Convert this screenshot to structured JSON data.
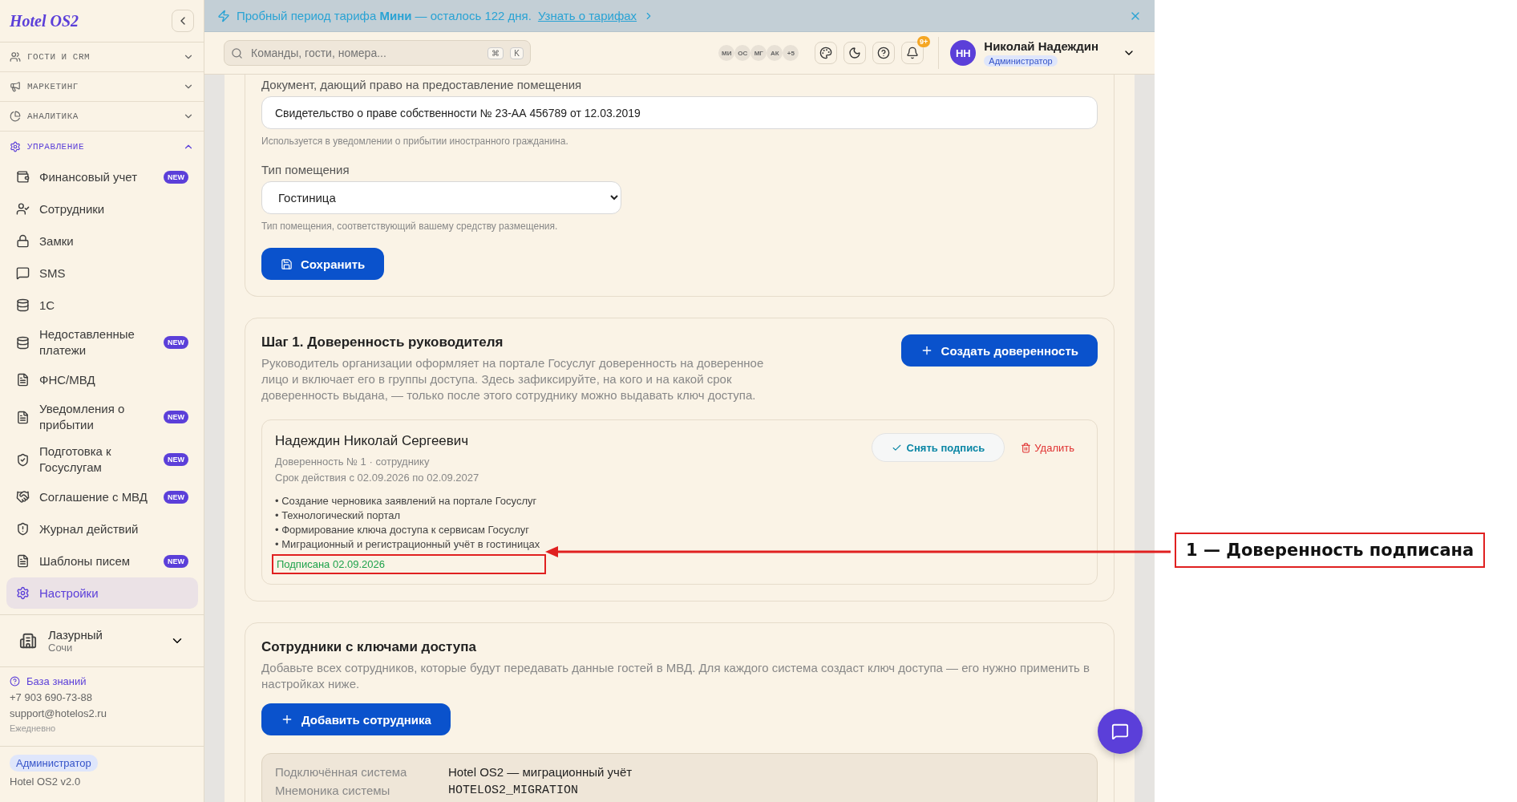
{
  "banner": {
    "text_before": "Пробный период тарифа",
    "tariff": "Мини",
    "text_after": "— осталось 122 дня.",
    "link": "Узнать о тарифах"
  },
  "search": {
    "placeholder": "Команды, гости, номера...",
    "keys": [
      "⌘",
      "K"
    ]
  },
  "avatars": [
    "МИ",
    "ОС",
    "МГ",
    "АК"
  ],
  "avatars_more": "+5",
  "notifications": "9+",
  "user": {
    "initials": "НН",
    "name": "Николай Надеждин",
    "role": "Администратор"
  },
  "sidebar": {
    "logo": "Hotel OS2",
    "sections": [
      {
        "label": "ГОСТИ И CRM",
        "expanded": false
      },
      {
        "label": "МАРКЕТИНГ",
        "expanded": false
      },
      {
        "label": "АНАЛИТИКА",
        "expanded": false
      },
      {
        "label": "УПРАВЛЕНИЕ",
        "expanded": true,
        "items": [
          {
            "label": "Финансовый учет",
            "badge": "NEW",
            "selected": false
          },
          {
            "label": "Сотрудники",
            "selected": false
          },
          {
            "label": "Замки",
            "selected": false
          },
          {
            "label": "SMS",
            "selected": false
          },
          {
            "label": "1С",
            "selected": false
          },
          {
            "label": "Недоставленные платежи",
            "badge": "NEW",
            "selected": false
          },
          {
            "label": "ФНС/МВД",
            "selected": false
          },
          {
            "label": "Уведомления о прибытии",
            "badge": "NEW",
            "selected": false
          },
          {
            "label": "Подготовка к Госуслугам",
            "badge": "NEW",
            "selected": false
          },
          {
            "label": "Соглашение с МВД",
            "badge": "NEW",
            "selected": false
          },
          {
            "label": "Журнал действий",
            "selected": false
          },
          {
            "label": "Шаблоны писем",
            "badge": "NEW",
            "selected": false
          },
          {
            "label": "Настройки",
            "selected": true
          }
        ]
      }
    ],
    "property": {
      "name": "Лазурный",
      "city": "Сочи"
    },
    "help": {
      "link": "База знаний",
      "phone": "+7 903 690-73-88",
      "email": "support@hotelos2.ru",
      "hours": "Ежедневно"
    },
    "role": "Администратор",
    "version": "Hotel OS2 v2.0"
  },
  "form": {
    "doc_label": "Документ, дающий право на предоставление помещения",
    "doc_value": "Свидетельство о праве собственности № 23-АА 456789 от 12.03.2019",
    "doc_hint": "Используется в уведомлении о прибытии иностранного гражданина.",
    "type_label": "Тип помещения",
    "type_value": "Гостиница",
    "type_hint": "Тип помещения, соответствующий вашему средству размещения.",
    "save": "Сохранить"
  },
  "step": {
    "title": "Шаг 1. Доверенность руководителя",
    "description": "Руководитель организации оформляет на портале Госуслуг доверенность на доверенное лицо и включает его в группы доступа. Здесь зафиксируйте, на кого и на какой срок доверенность выдана, — только после этого сотруднику можно выдавать ключ доступа.",
    "create": "Создать доверенность",
    "proxy": {
      "name": "Надеждин Николай Сергеевич",
      "number": "Доверенность № 1 · сотруднику",
      "validity": "Срок действия с 02.09.2026 по 02.09.2027",
      "permissions": [
        "• Создание черновика заявлений на портале Госуслуг",
        "• Технологический портал",
        "• Формирование ключа доступа к сервисам Госуслуг",
        "• Миграционный и регистрационный учёт в гостиницах"
      ],
      "signed": true,
      "status": "Подписана 02.09.2026",
      "unsign": "Снять подпись",
      "delete": "Удалить"
    }
  },
  "employees": {
    "title": "Сотрудники с ключами доступа",
    "description": "Добавьте всех сотрудников, которые будут передавать данные гостей в МВД. Для каждого система создаст ключ доступа — его нужно применить в настройках ниже.",
    "add": "Добавить сотрудника",
    "system": [
      {
        "label": "Подключённая система",
        "value": "Hotel OS2 — миграционный учёт",
        "kind": "text"
      },
      {
        "label": "Мнемоника системы",
        "value": "HOTELOS2_MIGRATION",
        "kind": "code"
      }
    ]
  },
  "annotation": "1 — Доверенность подписана"
}
